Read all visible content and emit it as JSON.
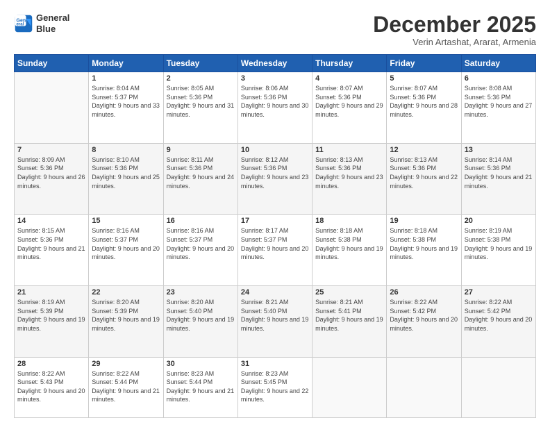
{
  "logo": {
    "line1": "General",
    "line2": "Blue"
  },
  "title": "December 2025",
  "location": "Verin Artashat, Ararat, Armenia",
  "header_days": [
    "Sunday",
    "Monday",
    "Tuesday",
    "Wednesday",
    "Thursday",
    "Friday",
    "Saturday"
  ],
  "weeks": [
    [
      {
        "day": "",
        "sunrise": "",
        "sunset": "",
        "daylight": ""
      },
      {
        "day": "1",
        "sunrise": "Sunrise: 8:04 AM",
        "sunset": "Sunset: 5:37 PM",
        "daylight": "Daylight: 9 hours and 33 minutes."
      },
      {
        "day": "2",
        "sunrise": "Sunrise: 8:05 AM",
        "sunset": "Sunset: 5:36 PM",
        "daylight": "Daylight: 9 hours and 31 minutes."
      },
      {
        "day": "3",
        "sunrise": "Sunrise: 8:06 AM",
        "sunset": "Sunset: 5:36 PM",
        "daylight": "Daylight: 9 hours and 30 minutes."
      },
      {
        "day": "4",
        "sunrise": "Sunrise: 8:07 AM",
        "sunset": "Sunset: 5:36 PM",
        "daylight": "Daylight: 9 hours and 29 minutes."
      },
      {
        "day": "5",
        "sunrise": "Sunrise: 8:07 AM",
        "sunset": "Sunset: 5:36 PM",
        "daylight": "Daylight: 9 hours and 28 minutes."
      },
      {
        "day": "6",
        "sunrise": "Sunrise: 8:08 AM",
        "sunset": "Sunset: 5:36 PM",
        "daylight": "Daylight: 9 hours and 27 minutes."
      }
    ],
    [
      {
        "day": "7",
        "sunrise": "Sunrise: 8:09 AM",
        "sunset": "Sunset: 5:36 PM",
        "daylight": "Daylight: 9 hours and 26 minutes."
      },
      {
        "day": "8",
        "sunrise": "Sunrise: 8:10 AM",
        "sunset": "Sunset: 5:36 PM",
        "daylight": "Daylight: 9 hours and 25 minutes."
      },
      {
        "day": "9",
        "sunrise": "Sunrise: 8:11 AM",
        "sunset": "Sunset: 5:36 PM",
        "daylight": "Daylight: 9 hours and 24 minutes."
      },
      {
        "day": "10",
        "sunrise": "Sunrise: 8:12 AM",
        "sunset": "Sunset: 5:36 PM",
        "daylight": "Daylight: 9 hours and 23 minutes."
      },
      {
        "day": "11",
        "sunrise": "Sunrise: 8:13 AM",
        "sunset": "Sunset: 5:36 PM",
        "daylight": "Daylight: 9 hours and 23 minutes."
      },
      {
        "day": "12",
        "sunrise": "Sunrise: 8:13 AM",
        "sunset": "Sunset: 5:36 PM",
        "daylight": "Daylight: 9 hours and 22 minutes."
      },
      {
        "day": "13",
        "sunrise": "Sunrise: 8:14 AM",
        "sunset": "Sunset: 5:36 PM",
        "daylight": "Daylight: 9 hours and 21 minutes."
      }
    ],
    [
      {
        "day": "14",
        "sunrise": "Sunrise: 8:15 AM",
        "sunset": "Sunset: 5:36 PM",
        "daylight": "Daylight: 9 hours and 21 minutes."
      },
      {
        "day": "15",
        "sunrise": "Sunrise: 8:16 AM",
        "sunset": "Sunset: 5:37 PM",
        "daylight": "Daylight: 9 hours and 20 minutes."
      },
      {
        "day": "16",
        "sunrise": "Sunrise: 8:16 AM",
        "sunset": "Sunset: 5:37 PM",
        "daylight": "Daylight: 9 hours and 20 minutes."
      },
      {
        "day": "17",
        "sunrise": "Sunrise: 8:17 AM",
        "sunset": "Sunset: 5:37 PM",
        "daylight": "Daylight: 9 hours and 20 minutes."
      },
      {
        "day": "18",
        "sunrise": "Sunrise: 8:18 AM",
        "sunset": "Sunset: 5:38 PM",
        "daylight": "Daylight: 9 hours and 19 minutes."
      },
      {
        "day": "19",
        "sunrise": "Sunrise: 8:18 AM",
        "sunset": "Sunset: 5:38 PM",
        "daylight": "Daylight: 9 hours and 19 minutes."
      },
      {
        "day": "20",
        "sunrise": "Sunrise: 8:19 AM",
        "sunset": "Sunset: 5:38 PM",
        "daylight": "Daylight: 9 hours and 19 minutes."
      }
    ],
    [
      {
        "day": "21",
        "sunrise": "Sunrise: 8:19 AM",
        "sunset": "Sunset: 5:39 PM",
        "daylight": "Daylight: 9 hours and 19 minutes."
      },
      {
        "day": "22",
        "sunrise": "Sunrise: 8:20 AM",
        "sunset": "Sunset: 5:39 PM",
        "daylight": "Daylight: 9 hours and 19 minutes."
      },
      {
        "day": "23",
        "sunrise": "Sunrise: 8:20 AM",
        "sunset": "Sunset: 5:40 PM",
        "daylight": "Daylight: 9 hours and 19 minutes."
      },
      {
        "day": "24",
        "sunrise": "Sunrise: 8:21 AM",
        "sunset": "Sunset: 5:40 PM",
        "daylight": "Daylight: 9 hours and 19 minutes."
      },
      {
        "day": "25",
        "sunrise": "Sunrise: 8:21 AM",
        "sunset": "Sunset: 5:41 PM",
        "daylight": "Daylight: 9 hours and 19 minutes."
      },
      {
        "day": "26",
        "sunrise": "Sunrise: 8:22 AM",
        "sunset": "Sunset: 5:42 PM",
        "daylight": "Daylight: 9 hours and 20 minutes."
      },
      {
        "day": "27",
        "sunrise": "Sunrise: 8:22 AM",
        "sunset": "Sunset: 5:42 PM",
        "daylight": "Daylight: 9 hours and 20 minutes."
      }
    ],
    [
      {
        "day": "28",
        "sunrise": "Sunrise: 8:22 AM",
        "sunset": "Sunset: 5:43 PM",
        "daylight": "Daylight: 9 hours and 20 minutes."
      },
      {
        "day": "29",
        "sunrise": "Sunrise: 8:22 AM",
        "sunset": "Sunset: 5:44 PM",
        "daylight": "Daylight: 9 hours and 21 minutes."
      },
      {
        "day": "30",
        "sunrise": "Sunrise: 8:23 AM",
        "sunset": "Sunset: 5:44 PM",
        "daylight": "Daylight: 9 hours and 21 minutes."
      },
      {
        "day": "31",
        "sunrise": "Sunrise: 8:23 AM",
        "sunset": "Sunset: 5:45 PM",
        "daylight": "Daylight: 9 hours and 22 minutes."
      },
      {
        "day": "",
        "sunrise": "",
        "sunset": "",
        "daylight": ""
      },
      {
        "day": "",
        "sunrise": "",
        "sunset": "",
        "daylight": ""
      },
      {
        "day": "",
        "sunrise": "",
        "sunset": "",
        "daylight": ""
      }
    ]
  ]
}
